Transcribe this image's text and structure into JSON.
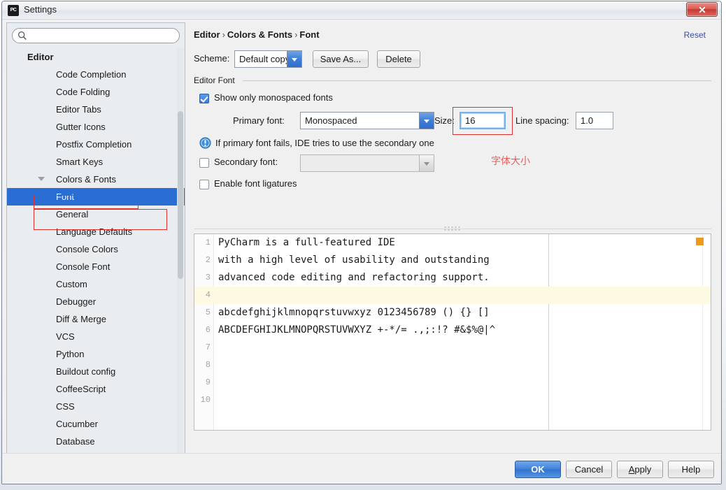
{
  "window": {
    "title": "Settings",
    "app_icon": "pycharm-icon",
    "close_label": "x"
  },
  "search": {
    "value": "",
    "placeholder": "",
    "icon": "search-icon"
  },
  "tree": {
    "root_label": "Editor",
    "items": [
      {
        "label": "Code Completion",
        "level": "child",
        "selected": false,
        "expandable": false
      },
      {
        "label": "Code Folding",
        "level": "child",
        "selected": false,
        "expandable": false
      },
      {
        "label": "Editor Tabs",
        "level": "child",
        "selected": false,
        "expandable": false
      },
      {
        "label": "Gutter Icons",
        "level": "child",
        "selected": false,
        "expandable": false
      },
      {
        "label": "Postfix Completion",
        "level": "child",
        "selected": false,
        "expandable": false
      },
      {
        "label": "Smart Keys",
        "level": "child",
        "selected": false,
        "expandable": false
      },
      {
        "label": "Colors & Fonts",
        "level": "child",
        "selected": false,
        "expandable": true
      },
      {
        "label": "Font",
        "level": "grand",
        "selected": true,
        "expandable": false
      },
      {
        "label": "General",
        "level": "grand",
        "selected": false,
        "expandable": false
      },
      {
        "label": "Language Defaults",
        "level": "child",
        "selected": false,
        "expandable": false
      },
      {
        "label": "Console Colors",
        "level": "child",
        "selected": false,
        "expandable": false
      },
      {
        "label": "Console Font",
        "level": "child",
        "selected": false,
        "expandable": false
      },
      {
        "label": "Custom",
        "level": "child",
        "selected": false,
        "expandable": false
      },
      {
        "label": "Debugger",
        "level": "child",
        "selected": false,
        "expandable": false
      },
      {
        "label": "Diff & Merge",
        "level": "child",
        "selected": false,
        "expandable": false
      },
      {
        "label": "VCS",
        "level": "child",
        "selected": false,
        "expandable": false
      },
      {
        "label": "Python",
        "level": "child",
        "selected": false,
        "expandable": false
      },
      {
        "label": "Buildout config",
        "level": "child",
        "selected": false,
        "expandable": false
      },
      {
        "label": "CoffeeScript",
        "level": "child",
        "selected": false,
        "expandable": false
      },
      {
        "label": "CSS",
        "level": "child",
        "selected": false,
        "expandable": false
      },
      {
        "label": "Cucumber",
        "level": "child",
        "selected": false,
        "expandable": false
      },
      {
        "label": "Database",
        "level": "child",
        "selected": false,
        "expandable": false
      }
    ]
  },
  "breadcrumb": {
    "part1": "Editor",
    "part2": "Colors & Fonts",
    "part3": "Font",
    "separator": "›"
  },
  "reset": {
    "label": "Reset"
  },
  "scheme": {
    "label": "Scheme:",
    "value": "Default copy",
    "save_as_label": "Save As...",
    "delete_label": "Delete"
  },
  "editor_font": {
    "group_title": "Editor Font",
    "show_monospaced_label": "Show only monospaced fonts",
    "show_monospaced_checked": true,
    "primary_font_label": "Primary font:",
    "primary_font_value": "Monospaced",
    "size_label": "Size:",
    "size_value": "16",
    "line_spacing_label": "Line spacing:",
    "line_spacing_value": "1.0",
    "hint_text": "If primary font fails, IDE tries to use the secondary one",
    "hint_icon": "info-icon",
    "secondary_font_label": "Secondary font:",
    "secondary_font_value": "",
    "secondary_font_checked": false,
    "ligatures_label": "Enable font ligatures",
    "ligatures_checked": false
  },
  "annotation": {
    "size_note": "字体大小",
    "color": "#e2605f"
  },
  "preview": {
    "marker_color": "#eb9a1e",
    "highlight_line": 4,
    "lines": [
      {
        "num": "1",
        "text": "PyCharm is a full-featured IDE"
      },
      {
        "num": "2",
        "text": "with a high level of usability and outstanding"
      },
      {
        "num": "3",
        "text": "advanced code editing and refactoring support."
      },
      {
        "num": "4",
        "text": ""
      },
      {
        "num": "5",
        "text": "abcdefghijklmnopqrstuvwxyz 0123456789 () {} []"
      },
      {
        "num": "6",
        "text": "ABCDEFGHIJKLMNOPQRSTUVWXYZ +-*/= .,;:!? #&$%@|^"
      },
      {
        "num": "7",
        "text": ""
      },
      {
        "num": "8",
        "text": ""
      },
      {
        "num": "9",
        "text": ""
      },
      {
        "num": "10",
        "text": ""
      }
    ]
  },
  "footer": {
    "ok_label": "OK",
    "cancel_label": "Cancel",
    "apply_label": "Apply",
    "help_label": "Help"
  }
}
